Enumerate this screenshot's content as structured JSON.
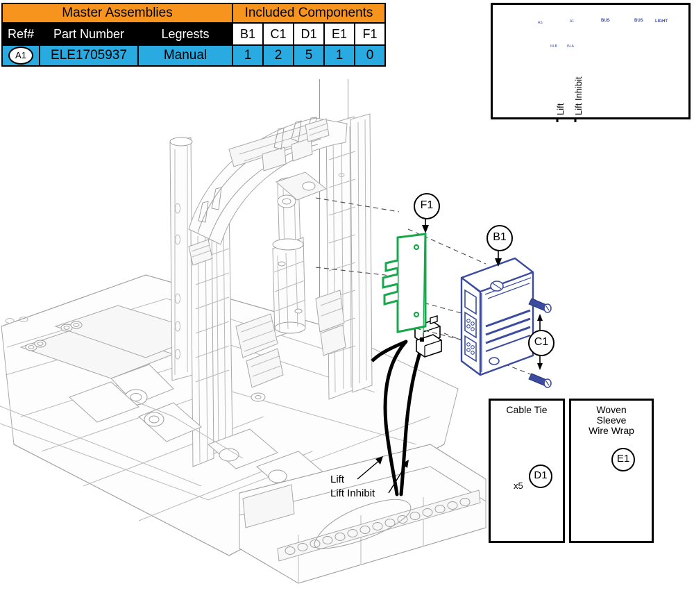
{
  "table": {
    "group_headers": [
      {
        "label": "Master Assemblies",
        "span": 3
      },
      {
        "label": "Included Components",
        "span": 5
      }
    ],
    "columns": [
      "Ref#",
      "Part Number",
      "Legrests",
      "B1",
      "C1",
      "D1",
      "E1",
      "F1"
    ],
    "rows": [
      {
        "ref": "A1",
        "part_number": "ELE1705937",
        "legrests": "Manual",
        "counts": [
          "1",
          "2",
          "5",
          "1",
          "0"
        ]
      }
    ],
    "colors": {
      "header": "#F7941E",
      "subheader": "#000000",
      "row": "#29ABE2"
    }
  },
  "inset_connector": {
    "title": "",
    "port_labels": [
      "AS",
      "A1",
      "IN-B",
      "IN-A",
      "BUS",
      "BUS",
      "LIGHT"
    ],
    "wire_labels": [
      "Lift",
      "Lift Inhibit"
    ]
  },
  "callouts": [
    {
      "id": "F1",
      "name": "bracket"
    },
    {
      "id": "B1",
      "name": "control-module"
    },
    {
      "id": "C1",
      "name": "screws"
    },
    {
      "id": "D1",
      "name": "cable-tie"
    },
    {
      "id": "E1",
      "name": "wire-wrap"
    }
  ],
  "legend_boxes": [
    {
      "id": "D1",
      "title": "Cable Tie",
      "quantity": "x5"
    },
    {
      "id": "E1",
      "title": "Woven\nSleeve\nWire Wrap",
      "title_lines": [
        "Woven",
        "Sleeve",
        "Wire Wrap"
      ]
    }
  ],
  "wire_callouts": [
    "Lift",
    "Lift Inhibit"
  ],
  "colors": {
    "orange": "#F7941E",
    "cyan": "#29ABE2",
    "module_blue": "#3B4BA0",
    "bracket_green": "#17A84B",
    "wrap_purple": "#8F8FD0",
    "line_gray": "#9a9a9a"
  }
}
